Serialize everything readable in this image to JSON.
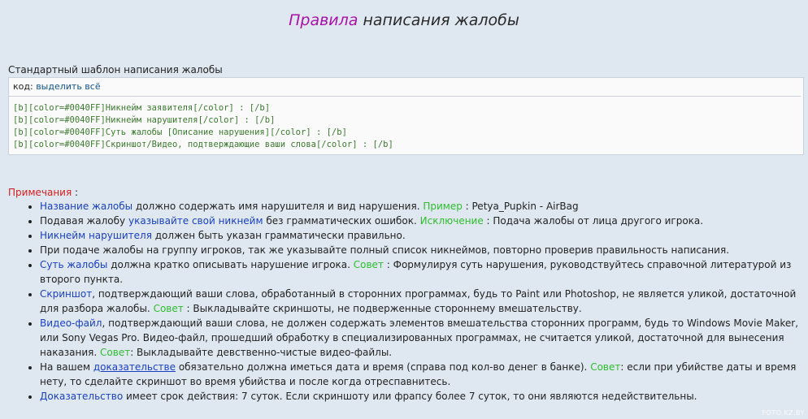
{
  "title": {
    "accent": "Правила",
    "rest": " написания жалобы"
  },
  "template": {
    "label": "Стандартный шаблон написания жалобы",
    "code_prefix": "код:",
    "select_all": "выделить всё",
    "lines": [
      "[b][color=#0040FF]Никнейм заявителя[/color] : [/b]",
      "[b][color=#0040FF]Никнейм нарушителя[/color] : [/b]",
      "[b][color=#0040FF]Суть жалобы [Описание нарушения][/color] : [/b]",
      "[b][color=#0040FF]Скриншот/Видео, подтверждающие ваши слова[/color] : [/b]"
    ]
  },
  "notes": {
    "heading": "Примечания",
    "heading_suffix": " :",
    "items": [
      {
        "a": "Название жалобы",
        "b": " должно содержать имя нарушителя и вид нарушения. ",
        "c": "Пример",
        "d": " : Petya_Pupkin - AirBag"
      },
      {
        "a": "Подавая жалобу ",
        "b": "указывайте свой никнейм",
        "c": " без грамматических ошибок. ",
        "d": "Исключение",
        "e": " : Подача жалобы от лица другого игрока."
      },
      {
        "a": "Никнейм нарушителя",
        "b": " должен быть указан грамматически правильно."
      },
      {
        "a": "При подаче жалобы на группу игроков, так же указывайте полный список никнеймов, повторно проверив правильность написания."
      },
      {
        "a": "Суть жалобы",
        "b": " должна кратко описывать нарушение игрока. ",
        "c": "Совет",
        "d": " : Формулируя суть нарушения, руководствуйтесь справочной литературой из второго пункта."
      },
      {
        "a": "Скриншот",
        "b": ", подтверждающий ваши слова, обработанный в сторонних программах, будь то Paint или Photoshop, не является уликой, достаточной для разбора жалобы. ",
        "c": "Совет",
        "d": " : Выкладывайте скриншоты, не подверженные стороннему вмешательству."
      },
      {
        "a": "Видео-файл",
        "b": ", подтверждающий ваши слова, не должен содержать элементов вмешательства сторонних программ, будь то Windows Movie Maker, или Sony Vegas Pro. Видео-файл, прошедший обработку в специализированных программах, не считается уликой, достаточной для вынесения наказания. ",
        "c": "Совет",
        "d": ": Выкладывайте девственно-чистые видео-файлы."
      },
      {
        "a": "На вашем ",
        "b": "доказательстве",
        "c": " обязательно должна иметься дата и время (справа под кол-во денег в банке). ",
        "d": "Совет",
        "e": ": если при убийстве даты и время нету, то сделайте скриншот во время убийства и после когда отреспавнитесь."
      },
      {
        "a": "Доказательство",
        "b": " имеет срок действия: 7 суток. Если скриншоту или фрапсу более 7 суток, то они являются недействительны."
      }
    ]
  },
  "watermark": "FOTO.KZ.BY",
  "colors": {
    "background": "#dfe8f1",
    "title_accent": "#aa11aa",
    "link_blue": "#1a3fc4",
    "tip_green": "#2dbd2d",
    "notes_red": "#d81d1d",
    "code_text": "#3b7a2f"
  }
}
